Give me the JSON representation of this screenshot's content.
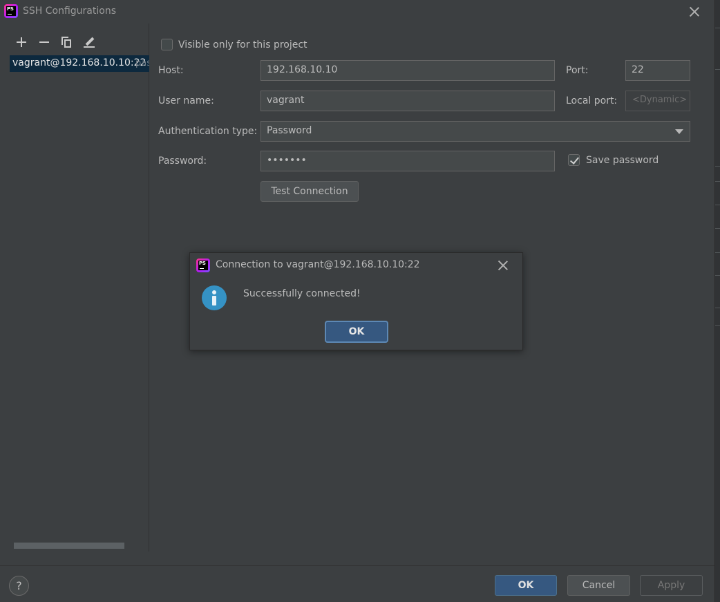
{
  "window": {
    "title": "SSH Configurations",
    "app_icon": "phpstorm-logo"
  },
  "toolbar": {
    "add_icon": "plus-icon",
    "remove_icon": "minus-icon",
    "copy_icon": "copy-icon",
    "edit_icon": "pencil-icon"
  },
  "config_list": {
    "items": [
      {
        "name": "vagrant@192.168.10.10:22",
        "suffix": "pas"
      }
    ]
  },
  "form": {
    "visible_only_label": "Visible only for this project",
    "visible_only_checked": false,
    "host_label": "Host:",
    "host_value": "192.168.10.10",
    "port_label": "Port:",
    "port_value": "22",
    "username_label": "User name:",
    "username_value": "vagrant",
    "local_port_label": "Local port:",
    "local_port_placeholder": "<Dynamic>",
    "auth_type_label": "Authentication type:",
    "auth_type_value": "Password",
    "password_label": "Password:",
    "password_value": "•••••••",
    "save_password_label": "Save password",
    "save_password_checked": true,
    "test_connection_label": "Test Connection"
  },
  "dialog": {
    "title": "Connection to vagrant@192.168.10.10:22",
    "message": "Successfully connected!",
    "ok_label": "OK",
    "icon": "info-icon"
  },
  "footer": {
    "help_label": "?",
    "ok_label": "OK",
    "cancel_label": "Cancel",
    "apply_label": "Apply"
  },
  "colors": {
    "background": "#3c3f41",
    "accent": "#365880",
    "selection": "#0d293e",
    "info": "#3592c4"
  }
}
